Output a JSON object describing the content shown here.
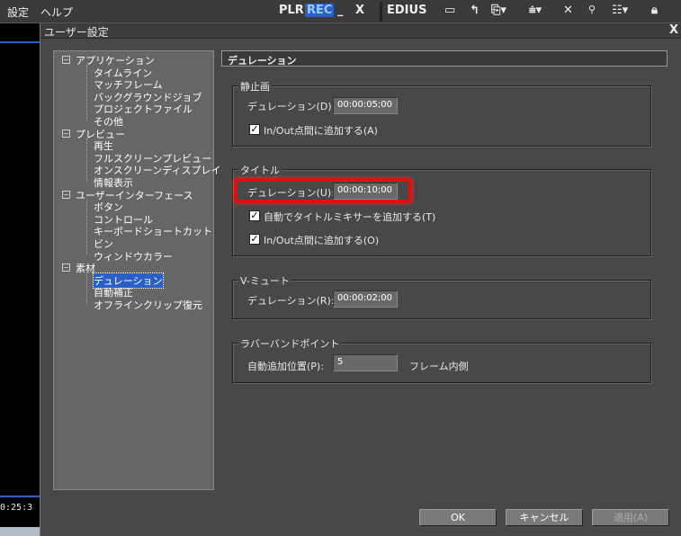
{
  "menubar": {
    "items": [
      "設定",
      "ヘルプ"
    ]
  },
  "toolbar": {
    "plr": "PLR",
    "rec": "REC",
    "minimize": "_",
    "close": "X",
    "brand": "EDIUS"
  },
  "side": {
    "timecode": "0:25:3"
  },
  "dialog": {
    "title": "ユーザー設定",
    "close": "X",
    "tree": [
      {
        "label": "アプリケーション",
        "children": [
          "タイムライン",
          "マッチフレーム",
          "バックグラウンドジョブ",
          "プロジェクトファイル",
          "その他"
        ]
      },
      {
        "label": "プレビュー",
        "children": [
          "再生",
          "フルスクリーンプレビュー",
          "オンスクリーンディスプレイ",
          "情報表示"
        ]
      },
      {
        "label": "ユーザーインターフェース",
        "children": [
          "ボタン",
          "コントロール",
          "キーボードショートカット",
          "ビン",
          "ウィンドウカラー"
        ]
      },
      {
        "label": "素材",
        "children": [
          "デュレーション",
          "自動補正",
          "オフラインクリップ復元"
        ]
      }
    ],
    "selected": "デュレーション",
    "header": "デュレーション",
    "still": {
      "title": "静止画",
      "duration_label": "デュレーション(D):",
      "duration": "00:00:05;00",
      "inout_label": "In/Out点間に追加する(A)",
      "inout_checked": true
    },
    "titlegrp": {
      "title": "タイトル",
      "duration_label": "デュレーション(U):",
      "duration": "00:00:10;00",
      "mixer_label": "自動でタイトルミキサーを追加する(T)",
      "mixer_checked": true,
      "inout_label": "In/Out点間に追加する(O)",
      "inout_checked": true
    },
    "vmute": {
      "title": "V-ミュート",
      "duration_label": "デュレーション(R):",
      "duration": "00:00:02;00"
    },
    "rubber": {
      "title": "ラバーバンドポイント",
      "pos_label": "自動追加位置(P):",
      "pos": "5",
      "unit": "フレーム内側"
    },
    "buttons": {
      "ok": "OK",
      "cancel": "キャンセル",
      "apply": "適用(A)"
    }
  }
}
